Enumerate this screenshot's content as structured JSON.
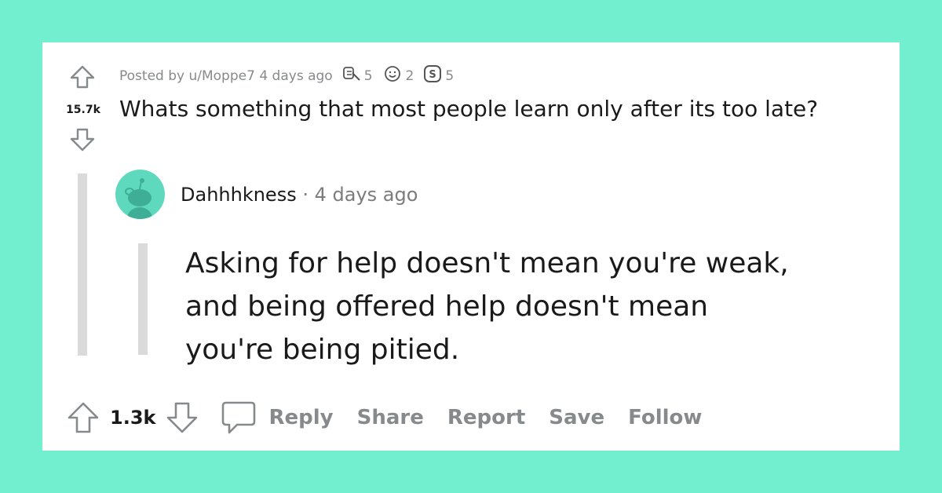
{
  "post": {
    "posted_by_prefix": "Posted by",
    "author": "u/Moppe7",
    "time_ago": "4 days ago",
    "awards": [
      {
        "icon": "helpful-award-icon",
        "count": "5"
      },
      {
        "icon": "wholesome-award-icon",
        "count": "2"
      },
      {
        "icon": "silver-award-icon",
        "count": "5"
      }
    ],
    "score": "15.7k",
    "title": "Whats something that most people learn only after its too late?"
  },
  "comment": {
    "username": "Dahhhkness",
    "separator": "·",
    "time_ago": "4 days ago",
    "text": "Asking for help doesn't mean you're weak, and being offered help doesn't mean you're being pitied.",
    "score": "1.3k",
    "actions": {
      "reply": "Reply",
      "share": "Share",
      "report": "Report",
      "save": "Save",
      "follow": "Follow"
    }
  },
  "colors": {
    "background": "#72efcf",
    "card": "#ffffff",
    "muted_text": "#878a8c",
    "avatar_bg": "#5fd9be"
  }
}
